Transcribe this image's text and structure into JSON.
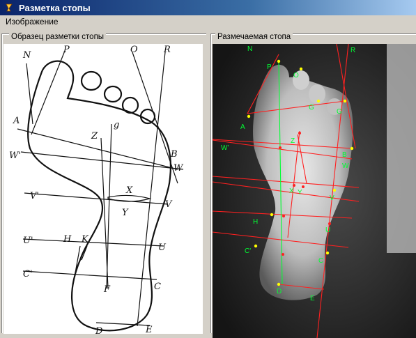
{
  "window": {
    "title": "Разметка стопы"
  },
  "menu": {
    "items": [
      {
        "label": "Изображение"
      }
    ]
  },
  "left_panel": {
    "title": "Образец разметки стопы",
    "labels": {
      "N": "N",
      "P": "P",
      "O": "O",
      "R": "R",
      "A": "A",
      "g": "g",
      "Z": "Z",
      "W1": "W'",
      "B": "B",
      "W": "W",
      "V1": "V'",
      "X": "X",
      "Y": "Y",
      "V": "V",
      "U1": "U'",
      "H": "H",
      "K": "K",
      "U": "U",
      "C1": "C'",
      "F": "F",
      "C": "C",
      "D": "D",
      "E": "E"
    }
  },
  "right_panel": {
    "title": "Размечаемая стопа",
    "labels": {
      "N": "N",
      "R": "R",
      "P": "P",
      "O": "O",
      "G": "G",
      "A": "A",
      "Z": "Z",
      "W1": "W'",
      "B": "B",
      "W": "W",
      "X": "X",
      "Y": "Y",
      "V": "V",
      "H": "H",
      "U": "U",
      "C1": "C'",
      "C": "C",
      "D": "D",
      "E": "E"
    },
    "colors": {
      "line_red": "#ff2020",
      "line_green": "#00ff33",
      "point": "#ffff00",
      "label": "#00ff33"
    }
  }
}
